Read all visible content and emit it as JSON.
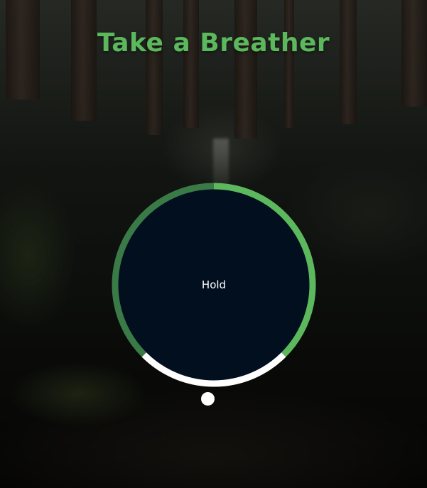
{
  "title": "Take a Breather",
  "breathing": {
    "phase_label": "Hold",
    "segments": [
      {
        "name": "inhale",
        "color": "#5cb85c",
        "share": 0.375
      },
      {
        "name": "hold",
        "color": "#ffffff",
        "share": 0.25
      },
      {
        "name": "exhale",
        "color": "#3a7a47",
        "share": 0.375
      }
    ],
    "circle_color": "#010f1f"
  }
}
